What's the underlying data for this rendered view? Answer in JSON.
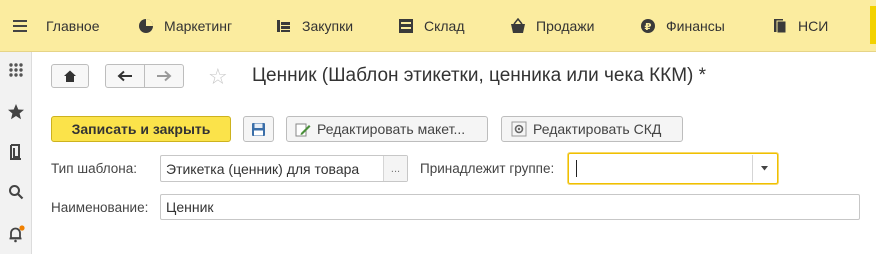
{
  "menu": {
    "items": [
      {
        "label": "Главное",
        "icon": "menu-lines-icon"
      },
      {
        "label": "Маркетинг",
        "icon": "pie-chart-icon"
      },
      {
        "label": "Закупки",
        "icon": "cart-icon"
      },
      {
        "label": "Склад",
        "icon": "warehouse-icon"
      },
      {
        "label": "Продажи",
        "icon": "basket-icon"
      },
      {
        "label": "Финансы",
        "icon": "ruble-coin-icon"
      },
      {
        "label": "НСИ",
        "icon": "book-icon"
      }
    ]
  },
  "sidebar": {
    "icons": [
      "apps-grid-icon",
      "favorites-star-icon",
      "history-icon",
      "search-icon",
      "notifications-bell-icon"
    ]
  },
  "form": {
    "title": "Ценник (Шаблон этикетки, ценника или чека ККМ) *",
    "buttons": {
      "save_close": "Записать и закрыть",
      "edit_layout": "Редактировать макет...",
      "edit_skd": "Редактировать СКД"
    },
    "fields": {
      "template_type_label": "Тип шаблона:",
      "template_type_value": "Этикетка (ценник) для товара",
      "template_type_select": "...",
      "group_label": "Принадлежит группе:",
      "group_value": "",
      "name_label": "Наименование:",
      "name_value": "Ценник"
    }
  },
  "colors": {
    "menu_bar": "#fbec9f",
    "primary_button": "#fbe34a",
    "focus_border": "#f0c000",
    "notification_dot": "#f08000"
  }
}
